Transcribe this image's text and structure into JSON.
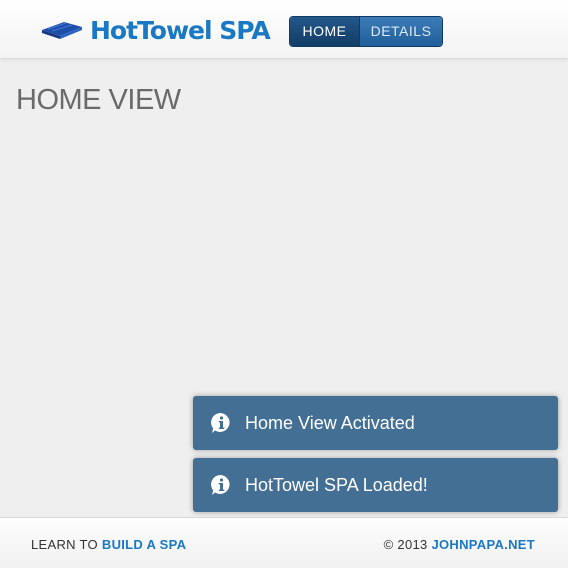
{
  "header": {
    "brand": "HotTowel SPA",
    "nav": [
      {
        "label": "HOME",
        "active": true
      },
      {
        "label": "DETAILS",
        "active": false
      }
    ]
  },
  "main": {
    "title": "HOME VIEW"
  },
  "toasts": [
    {
      "message": "Home View Activated",
      "icon": "info-icon"
    },
    {
      "message": "HotTowel SPA Loaded!",
      "icon": "info-icon"
    }
  ],
  "footer": {
    "left_prefix": "LEARN TO",
    "left_link": "BUILD A SPA",
    "right_prefix": "© 2013",
    "right_link": "JOHNPAPA.NET"
  },
  "colors": {
    "brand": "#1a79c4",
    "nav_active": "#123d66",
    "nav_inactive": "#2e6ea8",
    "toast_bg": "#436f95",
    "page_bg": "#efefef"
  }
}
